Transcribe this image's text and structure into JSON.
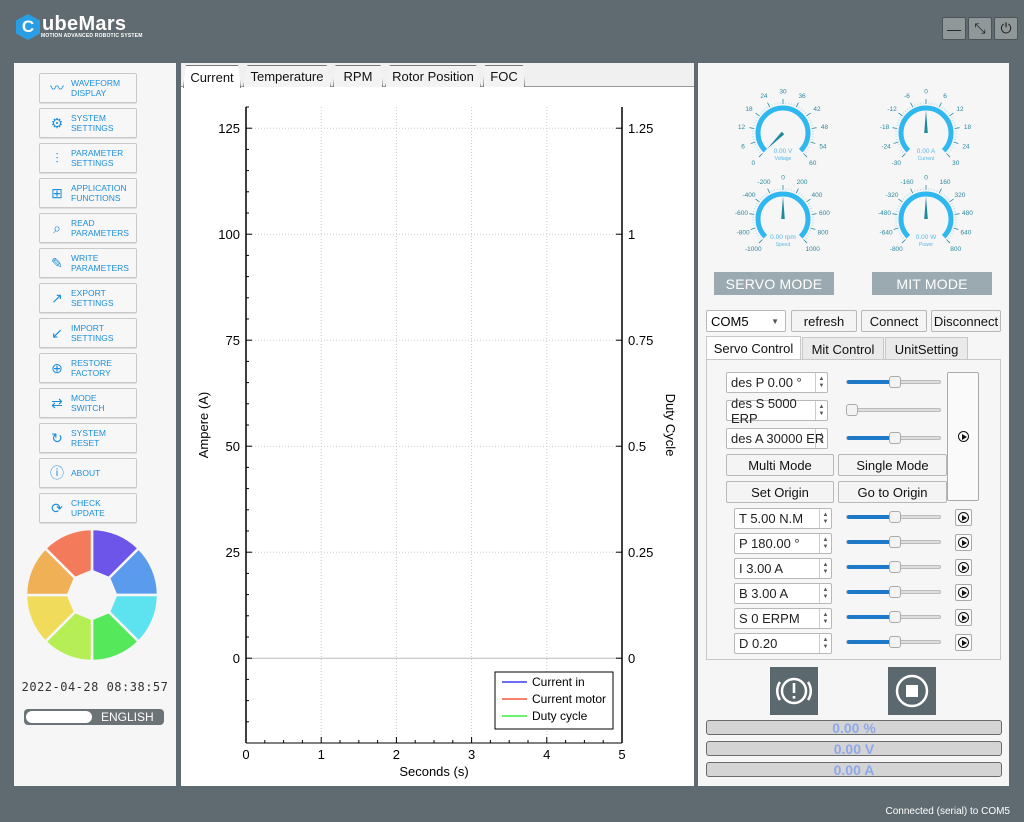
{
  "app": {
    "logo_letter": "C",
    "logo_name": "ubeMars",
    "logo_tagline": "MOTION ADVANCED ROBOTIC SYSTEM",
    "window_buttons": [
      {
        "icon": "minimize-icon",
        "glyph": "—"
      },
      {
        "icon": "maximize-icon",
        "glyph": "⤡"
      },
      {
        "icon": "power-icon",
        "glyph": "⏻"
      }
    ],
    "status_text": "Connected (serial) to COM5"
  },
  "sidebar": {
    "items": [
      {
        "label": "WAVEFORM\nDISPLAY",
        "icon": "waveform-icon",
        "glyph": "〰"
      },
      {
        "label": "SYSTEM\nSETTINGS",
        "icon": "gear-icon",
        "glyph": "⚙"
      },
      {
        "label": "PARAMETER\nSETTINGS",
        "icon": "sliders-icon",
        "glyph": "⫶"
      },
      {
        "label": "APPLICATION\nFUNCTIONS",
        "icon": "apps-icon",
        "glyph": "⊞"
      },
      {
        "label": "READ\nPARAMETERS",
        "icon": "read-chart-icon",
        "glyph": "⌕"
      },
      {
        "label": "WRITE\nPARAMETERS",
        "icon": "write-chart-icon",
        "glyph": "✎"
      },
      {
        "label": "EXPORT\nSETTINGS",
        "icon": "export-icon",
        "glyph": "↗"
      },
      {
        "label": "IMPORT\nSETTINGS",
        "icon": "import-icon",
        "glyph": "↙"
      },
      {
        "label": "RESTORE\nFACTORY",
        "icon": "restore-icon",
        "glyph": "⊕"
      },
      {
        "label": "MODE\nSWITCH",
        "icon": "switch-icon",
        "glyph": "⇄"
      },
      {
        "label": "SYSTEM\nRESET",
        "icon": "reset-icon",
        "glyph": "↻"
      },
      {
        "label": "ABOUT",
        "icon": "info-icon",
        "glyph": "ⓘ"
      },
      {
        "label": "CHECK\nUPDATE",
        "icon": "update-icon",
        "glyph": "⟳"
      }
    ],
    "wheel_colors": [
      "#6c55e8",
      "#5a9bee",
      "#5de3f0",
      "#55e85a",
      "#b6ee55",
      "#f0dc5a",
      "#f0b055",
      "#f47a5c"
    ],
    "datetime": "2022-04-28 08:38:57",
    "language": "ENGLISH"
  },
  "main": {
    "tabs": [
      {
        "label": "Current",
        "active": true
      },
      {
        "label": "Temperature",
        "active": false
      },
      {
        "label": "RPM",
        "active": false
      },
      {
        "label": "Rotor Position",
        "active": false
      },
      {
        "label": "FOC",
        "active": false
      }
    ]
  },
  "chart_data": {
    "type": "line",
    "xlabel": "Seconds (s)",
    "ylabel": "Ampere (A)",
    "y2label": "Duty Cycle",
    "xlim": [
      0,
      5
    ],
    "ylim": [
      -20,
      130
    ],
    "y2lim": [
      -0.2,
      1.3
    ],
    "xticks": [
      0,
      1,
      2,
      3,
      4,
      5
    ],
    "yticks": [
      0,
      25,
      50,
      75,
      100,
      125
    ],
    "y2ticks": [
      "0",
      "0.25",
      "0.5",
      "0.75",
      "1",
      "1.25"
    ],
    "grid": true,
    "legend_position": "bottom-right",
    "series": [
      {
        "name": "Current in",
        "color": "#3b3bf0",
        "values": []
      },
      {
        "name": "Current motor",
        "color": "#f05a3b",
        "values": []
      },
      {
        "name": "Duty cycle",
        "color": "#3bf03b",
        "values": []
      }
    ]
  },
  "gauges": [
    {
      "name": "voltage",
      "label": "Voltage",
      "value_text": "0.00 V",
      "min": 0,
      "max": 60,
      "ticks": [
        "0",
        "6",
        "12",
        "18",
        "24",
        "30",
        "36",
        "42",
        "48",
        "54",
        "60"
      ],
      "value": 0
    },
    {
      "name": "current",
      "label": "Current",
      "value_text": "0.00 A",
      "min": -30,
      "max": 30,
      "ticks": [
        "-30",
        "-24",
        "-18",
        "-12",
        "-6",
        "0",
        "6",
        "12",
        "18",
        "24",
        "30"
      ],
      "value": 0
    },
    {
      "name": "speed",
      "label": "Speed",
      "value_text": "0.00 rpm",
      "min": -1000,
      "max": 1000,
      "ticks": [
        "-1000",
        "-800",
        "-600",
        "-400",
        "-200",
        "0",
        "200",
        "400",
        "600",
        "800",
        "1000"
      ],
      "value": 0
    },
    {
      "name": "power",
      "label": "Power",
      "value_text": "0.00 W",
      "min": -800,
      "max": 800,
      "ticks": [
        "-800",
        "-640",
        "-480",
        "-320",
        "-160",
        "0",
        "160",
        "320",
        "480",
        "640",
        "800"
      ],
      "value": 0
    }
  ],
  "control": {
    "servo_mode_label": "SERVO MODE",
    "mit_mode_label": "MIT MODE",
    "port": "COM5",
    "refresh_label": "refresh",
    "connect_label": "Connect",
    "disconnect_label": "Disconnect",
    "sub_tabs": [
      {
        "label": "Servo Control",
        "active": true
      },
      {
        "label": "Mit Control",
        "active": false
      },
      {
        "label": "UnitSetting",
        "active": false
      }
    ],
    "des_fields": [
      {
        "value": "des P 0.00 °",
        "slider": 0.5
      },
      {
        "value": "des S 5000 ERP",
        "slider": 0.05
      },
      {
        "value": "des A 30000 ER",
        "slider": 0.5
      }
    ],
    "multi_mode_label": "Multi Mode",
    "single_mode_label": "Single Mode",
    "set_origin_label": "Set Origin",
    "go_origin_label": "Go to Origin",
    "param_fields": [
      {
        "value": "T 5.00 N.M",
        "slider": 0.5
      },
      {
        "value": "P 180.00 °",
        "slider": 0.5
      },
      {
        "value": "I 3.00 A",
        "slider": 0.5
      },
      {
        "value": "B 3.00 A",
        "slider": 0.5
      },
      {
        "value": "S 0 ERPM",
        "slider": 0.5
      },
      {
        "value": "D 0.20",
        "slider": 0.5
      }
    ],
    "readouts": [
      "0.00 %",
      "0.00 V",
      "0.00 A"
    ]
  }
}
